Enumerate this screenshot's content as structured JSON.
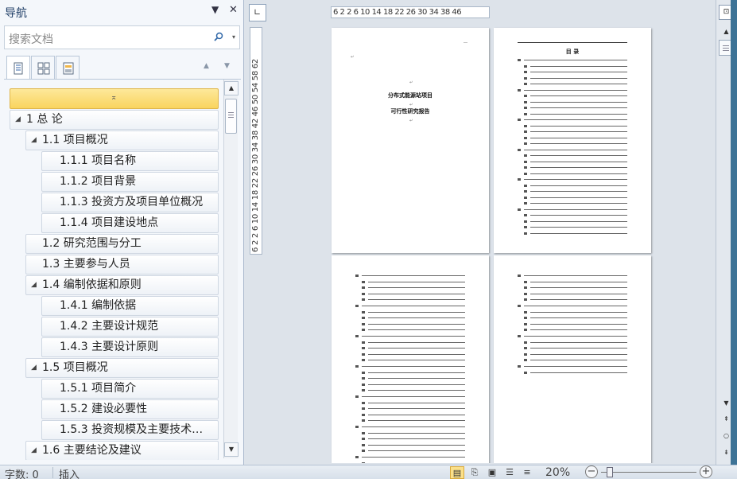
{
  "nav": {
    "title": "导航",
    "dropdown_icon": "▼",
    "close_icon": "✕",
    "search_placeholder": "搜索文档",
    "search_icon": "⌕",
    "search_dropdown_icon": "▾",
    "tabs": [
      "browse-headings",
      "browse-pages",
      "browse-results"
    ],
    "prev_icon": "▲",
    "next_icon": "▼",
    "collapse_icon": "⌅",
    "headings": [
      {
        "text": "1 总  论",
        "level": 1,
        "expanded": true
      },
      {
        "text": "1.1 项目概况",
        "level": 2,
        "expanded": true
      },
      {
        "text": "1.1.1 项目名称",
        "level": 3
      },
      {
        "text": "1.1.2 项目背景",
        "level": 3
      },
      {
        "text": "1.1.3 投资方及项目单位概况",
        "level": 3
      },
      {
        "text": "1.1.4 项目建设地点",
        "level": 3
      },
      {
        "text": "1.2 研究范围与分工",
        "level": 2
      },
      {
        "text": "1.3 主要参与人员",
        "level": 2
      },
      {
        "text": "1.4 编制依据和原则",
        "level": 2,
        "expanded": true
      },
      {
        "text": "1.4.1 编制依据",
        "level": 3
      },
      {
        "text": "1.4.2 主要设计规范",
        "level": 3
      },
      {
        "text": "1.4.3 主要设计原则",
        "level": 3
      },
      {
        "text": "1.5 项目概况",
        "level": 2,
        "expanded": true
      },
      {
        "text": "1.5.1 项目简介",
        "level": 3
      },
      {
        "text": "1.5.2 建设必要性",
        "level": 3
      },
      {
        "text": "1.5.3 投资规模及主要技术…",
        "level": 3
      },
      {
        "text": "1.6 主要结论及建议",
        "level": 2,
        "expanded": true
      }
    ]
  },
  "rulers": {
    "horizontal": "6  2 2  6 10 14 18 22 26 30 34 38    46",
    "vertical": "6  2  2  6 10 14 18 22 26 30 34 38 42 46 50  54  58 62"
  },
  "document": {
    "cover_title": "分布式能源站项目",
    "cover_subtitle": "可行性研究报告",
    "toc_heading": "目  录"
  },
  "status": {
    "word_count": "字数: 0",
    "mode": "插入",
    "zoom": "20%",
    "zoom_level_percent": 20,
    "zoom_minus": "−",
    "zoom_plus": "+"
  },
  "scrollbar": {
    "up": "▲",
    "down": "▼",
    "prev_page": "⇞",
    "select_browse": "○",
    "next_page": "⇟"
  }
}
